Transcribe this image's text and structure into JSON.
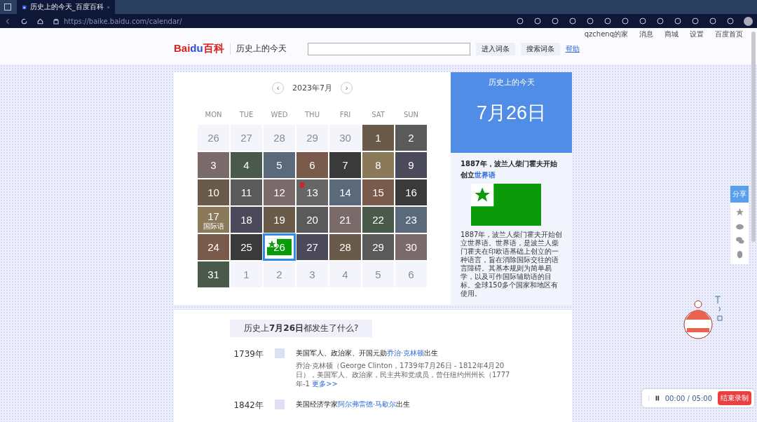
{
  "browser": {
    "tab_title": "历史上的今天_百度百科",
    "url": "https://baike.baidu.com/calendar/"
  },
  "userbar": {
    "user": "qzchenq的家",
    "links": [
      "消息",
      "商城",
      "设置",
      "百度首页"
    ]
  },
  "header": {
    "logo_left": "Bai",
    "logo_mid": "du",
    "logo_right": "百科",
    "page_title": "历史上的今天",
    "buttons": [
      "进入词条",
      "搜索词条"
    ],
    "help": "帮助"
  },
  "calendar": {
    "month": "2023年7月",
    "prev": "‹",
    "next": "›",
    "weekdays": [
      "MON",
      "TUE",
      "WED",
      "THU",
      "FRI",
      "SAT",
      "SUN"
    ],
    "cells": [
      {
        "day": "26",
        "in_month": false,
        "selected": false,
        "kind": "blank"
      },
      {
        "day": "27",
        "in_month": false,
        "selected": false,
        "kind": "blank"
      },
      {
        "day": "28",
        "in_month": false,
        "selected": false,
        "kind": "blank"
      },
      {
        "day": "29",
        "in_month": false,
        "selected": false,
        "kind": "blank"
      },
      {
        "day": "30",
        "in_month": false,
        "selected": false,
        "kind": "blank"
      },
      {
        "day": "1",
        "in_month": true,
        "selected": false,
        "kind": "photo"
      },
      {
        "day": "2",
        "in_month": true,
        "selected": false,
        "kind": "photo"
      },
      {
        "day": "3",
        "in_month": true,
        "selected": false,
        "kind": "photo"
      },
      {
        "day": "4",
        "in_month": true,
        "selected": false,
        "kind": "photo"
      },
      {
        "day": "5",
        "in_month": true,
        "selected": false,
        "kind": "photo"
      },
      {
        "day": "6",
        "in_month": true,
        "selected": false,
        "kind": "photo"
      },
      {
        "day": "7",
        "in_month": true,
        "selected": false,
        "kind": "photo"
      },
      {
        "day": "8",
        "in_month": true,
        "selected": false,
        "kind": "photo"
      },
      {
        "day": "9",
        "in_month": true,
        "selected": false,
        "kind": "photo"
      },
      {
        "day": "10",
        "in_month": true,
        "selected": false,
        "kind": "photo"
      },
      {
        "day": "11",
        "in_month": true,
        "selected": false,
        "kind": "photo"
      },
      {
        "day": "12",
        "in_month": true,
        "selected": false,
        "kind": "photo"
      },
      {
        "day": "13",
        "in_month": true,
        "selected": false,
        "kind": "emblem"
      },
      {
        "day": "14",
        "in_month": true,
        "selected": false,
        "kind": "photo"
      },
      {
        "day": "15",
        "in_month": true,
        "selected": false,
        "kind": "photo"
      },
      {
        "day": "16",
        "in_month": true,
        "selected": false,
        "kind": "photo"
      },
      {
        "day": "17",
        "in_month": true,
        "selected": false,
        "kind": "photo",
        "caption": "国际语"
      },
      {
        "day": "18",
        "in_month": true,
        "selected": false,
        "kind": "photo"
      },
      {
        "day": "19",
        "in_month": true,
        "selected": false,
        "kind": "photo"
      },
      {
        "day": "20",
        "in_month": true,
        "selected": false,
        "kind": "photo"
      },
      {
        "day": "21",
        "in_month": true,
        "selected": false,
        "kind": "photo"
      },
      {
        "day": "22",
        "in_month": true,
        "selected": false,
        "kind": "photo"
      },
      {
        "day": "23",
        "in_month": true,
        "selected": false,
        "kind": "photo"
      },
      {
        "day": "24",
        "in_month": true,
        "selected": false,
        "kind": "photo"
      },
      {
        "day": "25",
        "in_month": true,
        "selected": false,
        "kind": "photo"
      },
      {
        "day": "26",
        "in_month": true,
        "selected": true,
        "kind": "flag"
      },
      {
        "day": "27",
        "in_month": true,
        "selected": false,
        "kind": "photo"
      },
      {
        "day": "28",
        "in_month": true,
        "selected": false,
        "kind": "photo"
      },
      {
        "day": "29",
        "in_month": true,
        "selected": false,
        "kind": "photo"
      },
      {
        "day": "30",
        "in_month": true,
        "selected": false,
        "kind": "photo"
      },
      {
        "day": "31",
        "in_month": true,
        "selected": false,
        "kind": "photo"
      },
      {
        "day": "1",
        "in_month": false,
        "selected": false,
        "kind": "blank"
      },
      {
        "day": "2",
        "in_month": false,
        "selected": false,
        "kind": "blank"
      },
      {
        "day": "3",
        "in_month": false,
        "selected": false,
        "kind": "blank"
      },
      {
        "day": "4",
        "in_month": false,
        "selected": false,
        "kind": "blank"
      },
      {
        "day": "5",
        "in_month": false,
        "selected": false,
        "kind": "blank"
      },
      {
        "day": "6",
        "in_month": false,
        "selected": false,
        "kind": "blank"
      }
    ]
  },
  "today": {
    "label": "历史上的今天",
    "date": "7月26日",
    "headline": "1887年，波兰人柴门霍夫开始创立",
    "headline_link": "世界语",
    "description": "1887年，波兰人柴门霍夫开始创立世界语。世界语，是波兰人柴门霍夫在印欧语基础上创立的一种语言，旨在消除国际交往的语言障碍。其基本规则为简单易学，以及可作国际辅助语的目标。全球150多个国家和地区有使用。"
  },
  "events": {
    "heading": "历史上**7月26日**都发生了什么?",
    "items": [
      {
        "year": "1739年",
        "before": "美国军人、政治家、开国元勋",
        "link": "乔治·克林顿",
        "after": "出生",
        "detail": "乔治·克林顿（George Clinton，1739年7月26日 - 1812年4月20日），美国军人、政治家，民主共和党成员，曾任纽约州州长（1777年-1",
        "more": "更多>>"
      },
      {
        "year": "1842年",
        "before": "美国经济学家",
        "link": "阿尔弗雷德·马歇尔",
        "after": "出生"
      }
    ]
  },
  "share": {
    "label": "分享"
  },
  "recorder": {
    "time": "00:00 / 05:00",
    "stop": "结束录制"
  }
}
